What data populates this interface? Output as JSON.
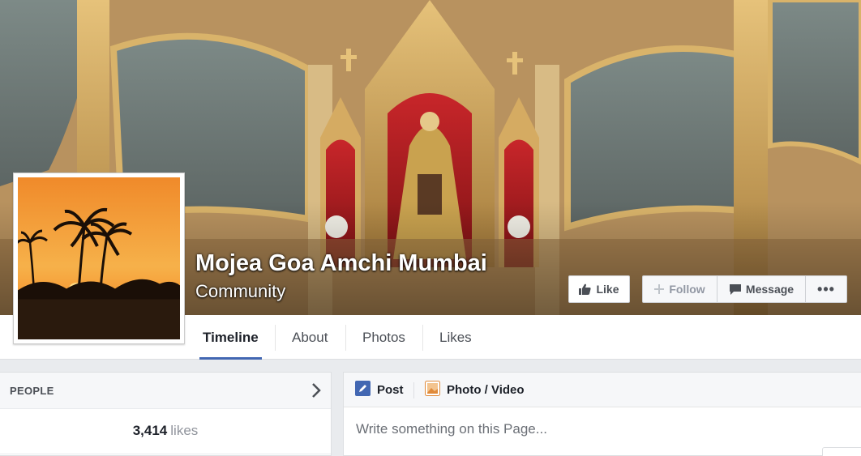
{
  "page": {
    "name": "Mojea Goa Amchi Mumbai",
    "category": "Community"
  },
  "actions": {
    "like_label": "Like",
    "follow_label": "Follow",
    "message_label": "Message",
    "more_label": "•••"
  },
  "tabs": [
    {
      "label": "Timeline",
      "active": true
    },
    {
      "label": "About",
      "active": false
    },
    {
      "label": "Photos",
      "active": false
    },
    {
      "label": "Likes",
      "active": false
    }
  ],
  "people": {
    "title": "PEOPLE",
    "likes_count": "3,414",
    "likes_label": "likes"
  },
  "composer": {
    "tab_post": "Post",
    "tab_photo_video": "Photo / Video",
    "placeholder": "Write something on this Page..."
  },
  "colors": {
    "accent": "#4267b2",
    "background": "#e9ebee",
    "text_dark": "#1d2129",
    "text_muted": "#90949c"
  },
  "icons": [
    "thumbs-up-icon",
    "plus-icon",
    "message-bubble-icon",
    "more-dots-icon",
    "chevron-right-icon",
    "pencil-icon",
    "photo-icon"
  ]
}
